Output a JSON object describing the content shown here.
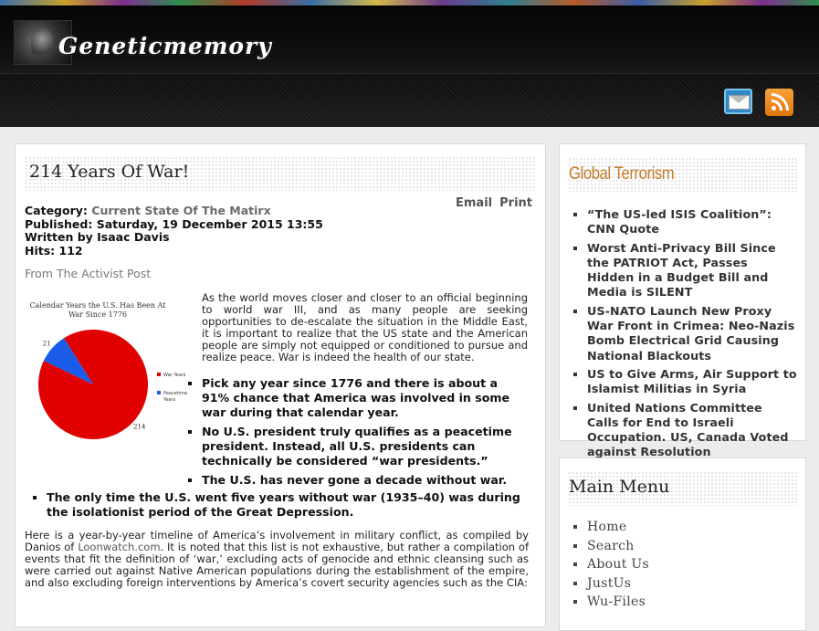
{
  "site": {
    "logo_text": "Geneticmemory"
  },
  "header": {
    "icons": [
      "mail-icon",
      "rss-icon"
    ]
  },
  "article": {
    "title": "214 Years Of War!",
    "actions": {
      "email": "Email",
      "print": "Print"
    },
    "meta": {
      "category_label": "Category:",
      "category": "Current State Of The Matirx",
      "published": "Published: Saturday, 19 December 2015 13:55",
      "author": "Written by Isaac Davis",
      "hits": "Hits: 112"
    },
    "source": "From The Activist Post",
    "intro": "As the world moves closer and closer to an official beginning to world war III, and as many people are seeking opportunities to de-escalate the situation in the Middle East, it is important to realize that the US state and the American people are simply not equipped or conditioned to pursue and realize peace. War is indeed the health of our state.",
    "bullets": [
      "Pick any year since 1776 and there is about a 91% chance that America was involved in some war during that calendar year.",
      "No U.S. president truly qualifies as a peacetime president. Instead, all U.S. presidents can technically be considered “war presidents.”",
      "The U.S. has never gone a decade without war.",
      "The only time the U.S. went five years without war (1935–40) was during the isolationist period of the Great Depression."
    ],
    "timeline": {
      "before": "Here is a year-by-year timeline of America’s involvement in military conflict, as compiled by Danios of ",
      "link": "Loonwatch.com",
      "after": ". It is noted that this list is not exhaustive, but rather a compilation of events that fit the definition of ‘war,’ excluding acts of genocide and ethnic cleansing such as were carried out against Native American populations during the establishment of the empire, and also excluding foreign interventions by America’s covert security agencies such as the CIA:"
    }
  },
  "chart_data": {
    "type": "pie",
    "title": "Calendar Years the U.S. Has Been At War Since 1776",
    "categories": [
      "War Years",
      "Peacetime Years"
    ],
    "values": [
      214,
      21
    ],
    "data_labels": [
      "214",
      "21"
    ],
    "colors": [
      "#e00000",
      "#1a5ce8"
    ],
    "legend": "right"
  },
  "sidebar": {
    "global_terrorism": {
      "title": "Global Terrorism",
      "items": [
        "“The US-led ISIS Coalition”: CNN Quote",
        "Worst Anti-Privacy Bill Since the PATRIOT Act, Passes Hidden in a Budget Bill and Media is SILENT",
        "US-NATO Launch New Proxy War Front in Crimea: Neo-Nazis Bomb Electrical Grid Causing National Blackouts",
        "US to Give Arms, Air Support to Islamist Militias in Syria",
        "United Nations Committee Calls for End to Israeli Occupation. US, Canada Voted against Resolution"
      ]
    },
    "main_menu": {
      "title": "Main Menu",
      "items": [
        "Home",
        "Search",
        "About Us",
        "JustUs",
        "Wu-Files"
      ]
    }
  }
}
